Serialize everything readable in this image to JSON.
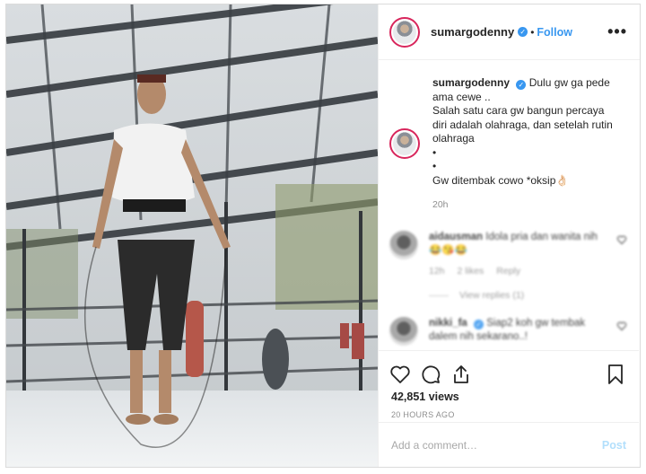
{
  "post": {
    "username": "sumargodenny",
    "follow_label": "Follow",
    "separator": "•",
    "more_label": "•••",
    "verified_mark": "✓",
    "caption_lines": [
      "Dulu gw ga pede",
      "ama cewe ..",
      "Salah satu cara gw bangun percaya",
      "diri adalah olahraga, dan setelah rutin",
      "olahraga",
      "•",
      "•",
      "Gw ditembak cowo *oksip👌🏻"
    ],
    "caption_time": "20h",
    "comments": [
      {
        "username": "aidausman",
        "text": "Idola pria dan wanita nih 😂😘😂",
        "time": "12h",
        "likes": "2 likes",
        "reply": "Reply",
        "view_replies": "View replies (1)"
      },
      {
        "username": "nikki_fa",
        "text": "Siap2 koh gw tembak dalem nih sekarano..!"
      }
    ],
    "views": "42,851 views",
    "time_ago": "20 HOURS AGO",
    "add_comment_placeholder": "Add a comment…",
    "post_label": "Post"
  },
  "icons": {
    "like": "heart-icon",
    "comment": "comment-icon",
    "share": "share-icon",
    "save": "bookmark-icon",
    "comment_like": "heart-icon"
  },
  "colors": {
    "link": "#3897f0",
    "border": "#dbdbdb",
    "muted": "#8e8e8e",
    "post_disabled": "#b2dffc",
    "avatar_ring": "#d8265c"
  }
}
